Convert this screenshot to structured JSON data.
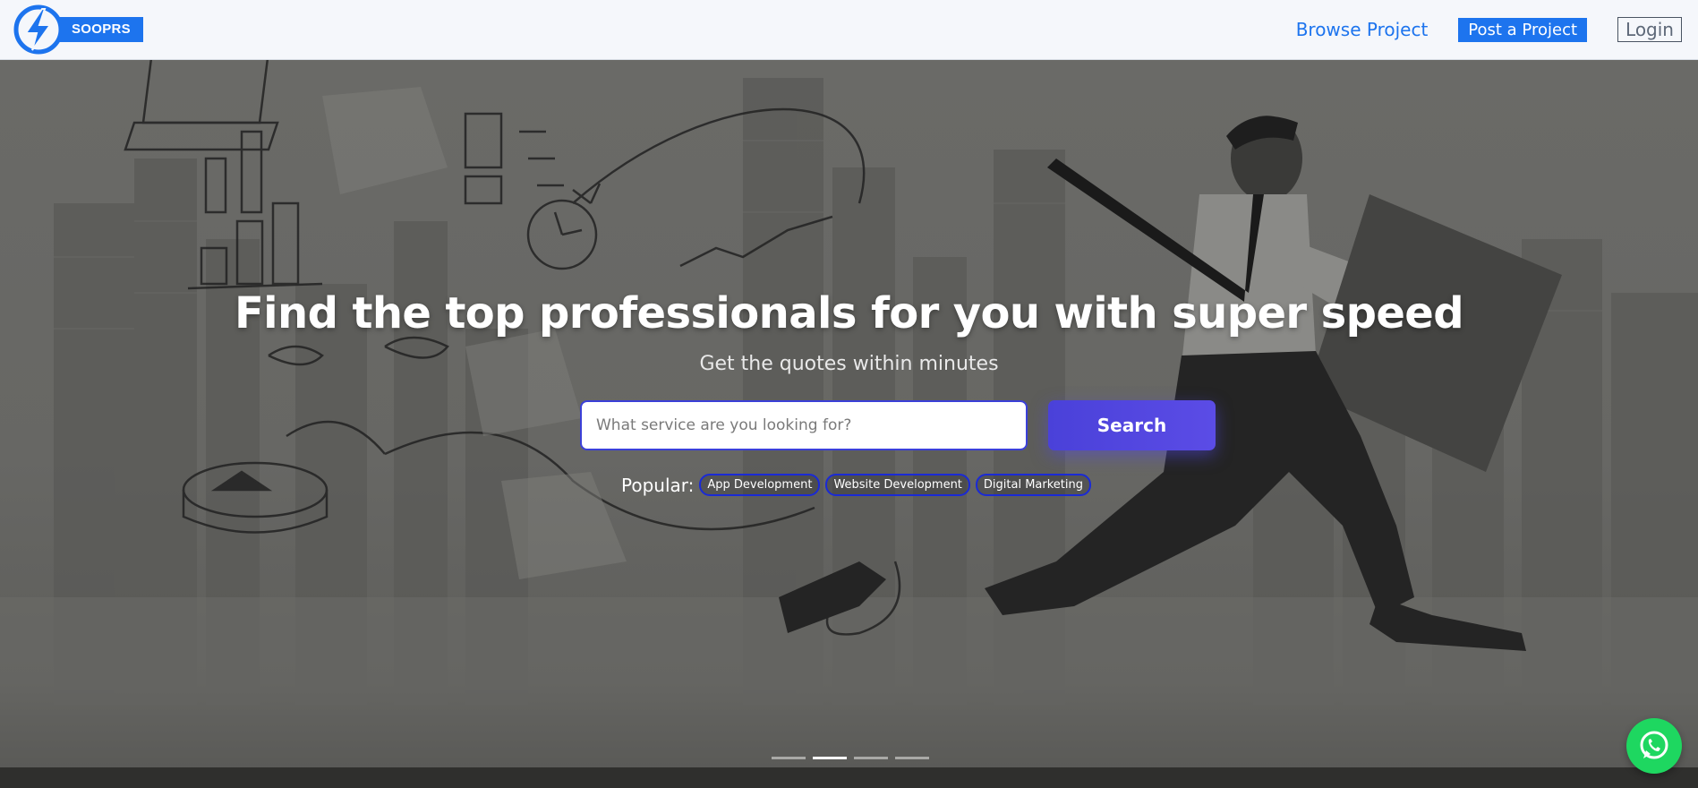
{
  "header": {
    "brand_name": "SOOPRS",
    "nav": {
      "browse": "Browse Project",
      "post": "Post a Project",
      "login": "Login"
    }
  },
  "hero": {
    "headline": "Find the top professionals for you with super speed",
    "subline": "Get the quotes within minutes",
    "search": {
      "placeholder": "What service are you looking for?",
      "value": "",
      "button_label": "Search"
    },
    "popular": {
      "label": "Popular:",
      "chips": [
        "App Development",
        "Website Development",
        "Digital Marketing"
      ]
    },
    "carousel": {
      "slides": 4,
      "active_index": 1
    }
  },
  "floating": {
    "icon": "whatsapp-icon"
  },
  "colors": {
    "brand_blue": "#1d74ee",
    "search_button": "#4a41d9",
    "chip_border": "#1a2ad6",
    "whatsapp_green": "#1ed760"
  }
}
